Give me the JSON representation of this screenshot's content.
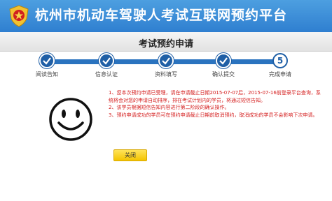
{
  "header": {
    "title": "杭州市机动车驾驶人考试互联网预约平台",
    "logo": "police-emblem-icon",
    "colors": {
      "bar": "#3a8ad8",
      "text": "#ffffff"
    }
  },
  "page": {
    "title": "考试预约申请"
  },
  "progress": {
    "steps": [
      {
        "label": "阅读告知",
        "state": "done",
        "icon": "check-icon"
      },
      {
        "label": "信息认证",
        "state": "done",
        "icon": "check-icon"
      },
      {
        "label": "资料填写",
        "state": "done",
        "icon": "check-icon"
      },
      {
        "label": "确认提交",
        "state": "done",
        "icon": "check-icon"
      },
      {
        "label": "完成申请",
        "state": "current",
        "number": "5"
      }
    ],
    "colors": {
      "active": "#1f5fa6"
    }
  },
  "result": {
    "icon": "smiley-face-icon",
    "notices": [
      "1、您本次预约申请已受理，请在申请截止日期2015-07-07后，2015-07-16前登录平台查询，系统将会对您的申请自动排序，排在考试计划内的学员，将通过短信告知。",
      "2、该学员根据短信告知内容进行第二阶段的确认操作。",
      "3、预约申请成功的学员可在预约申请截止日期前取消预约，取消成功的学员不会影响下次申请。"
    ],
    "colors": {
      "notice": "#d41c1c"
    }
  },
  "actions": {
    "close_label": "关闭",
    "colors": {
      "button": "#f7cc10"
    }
  }
}
